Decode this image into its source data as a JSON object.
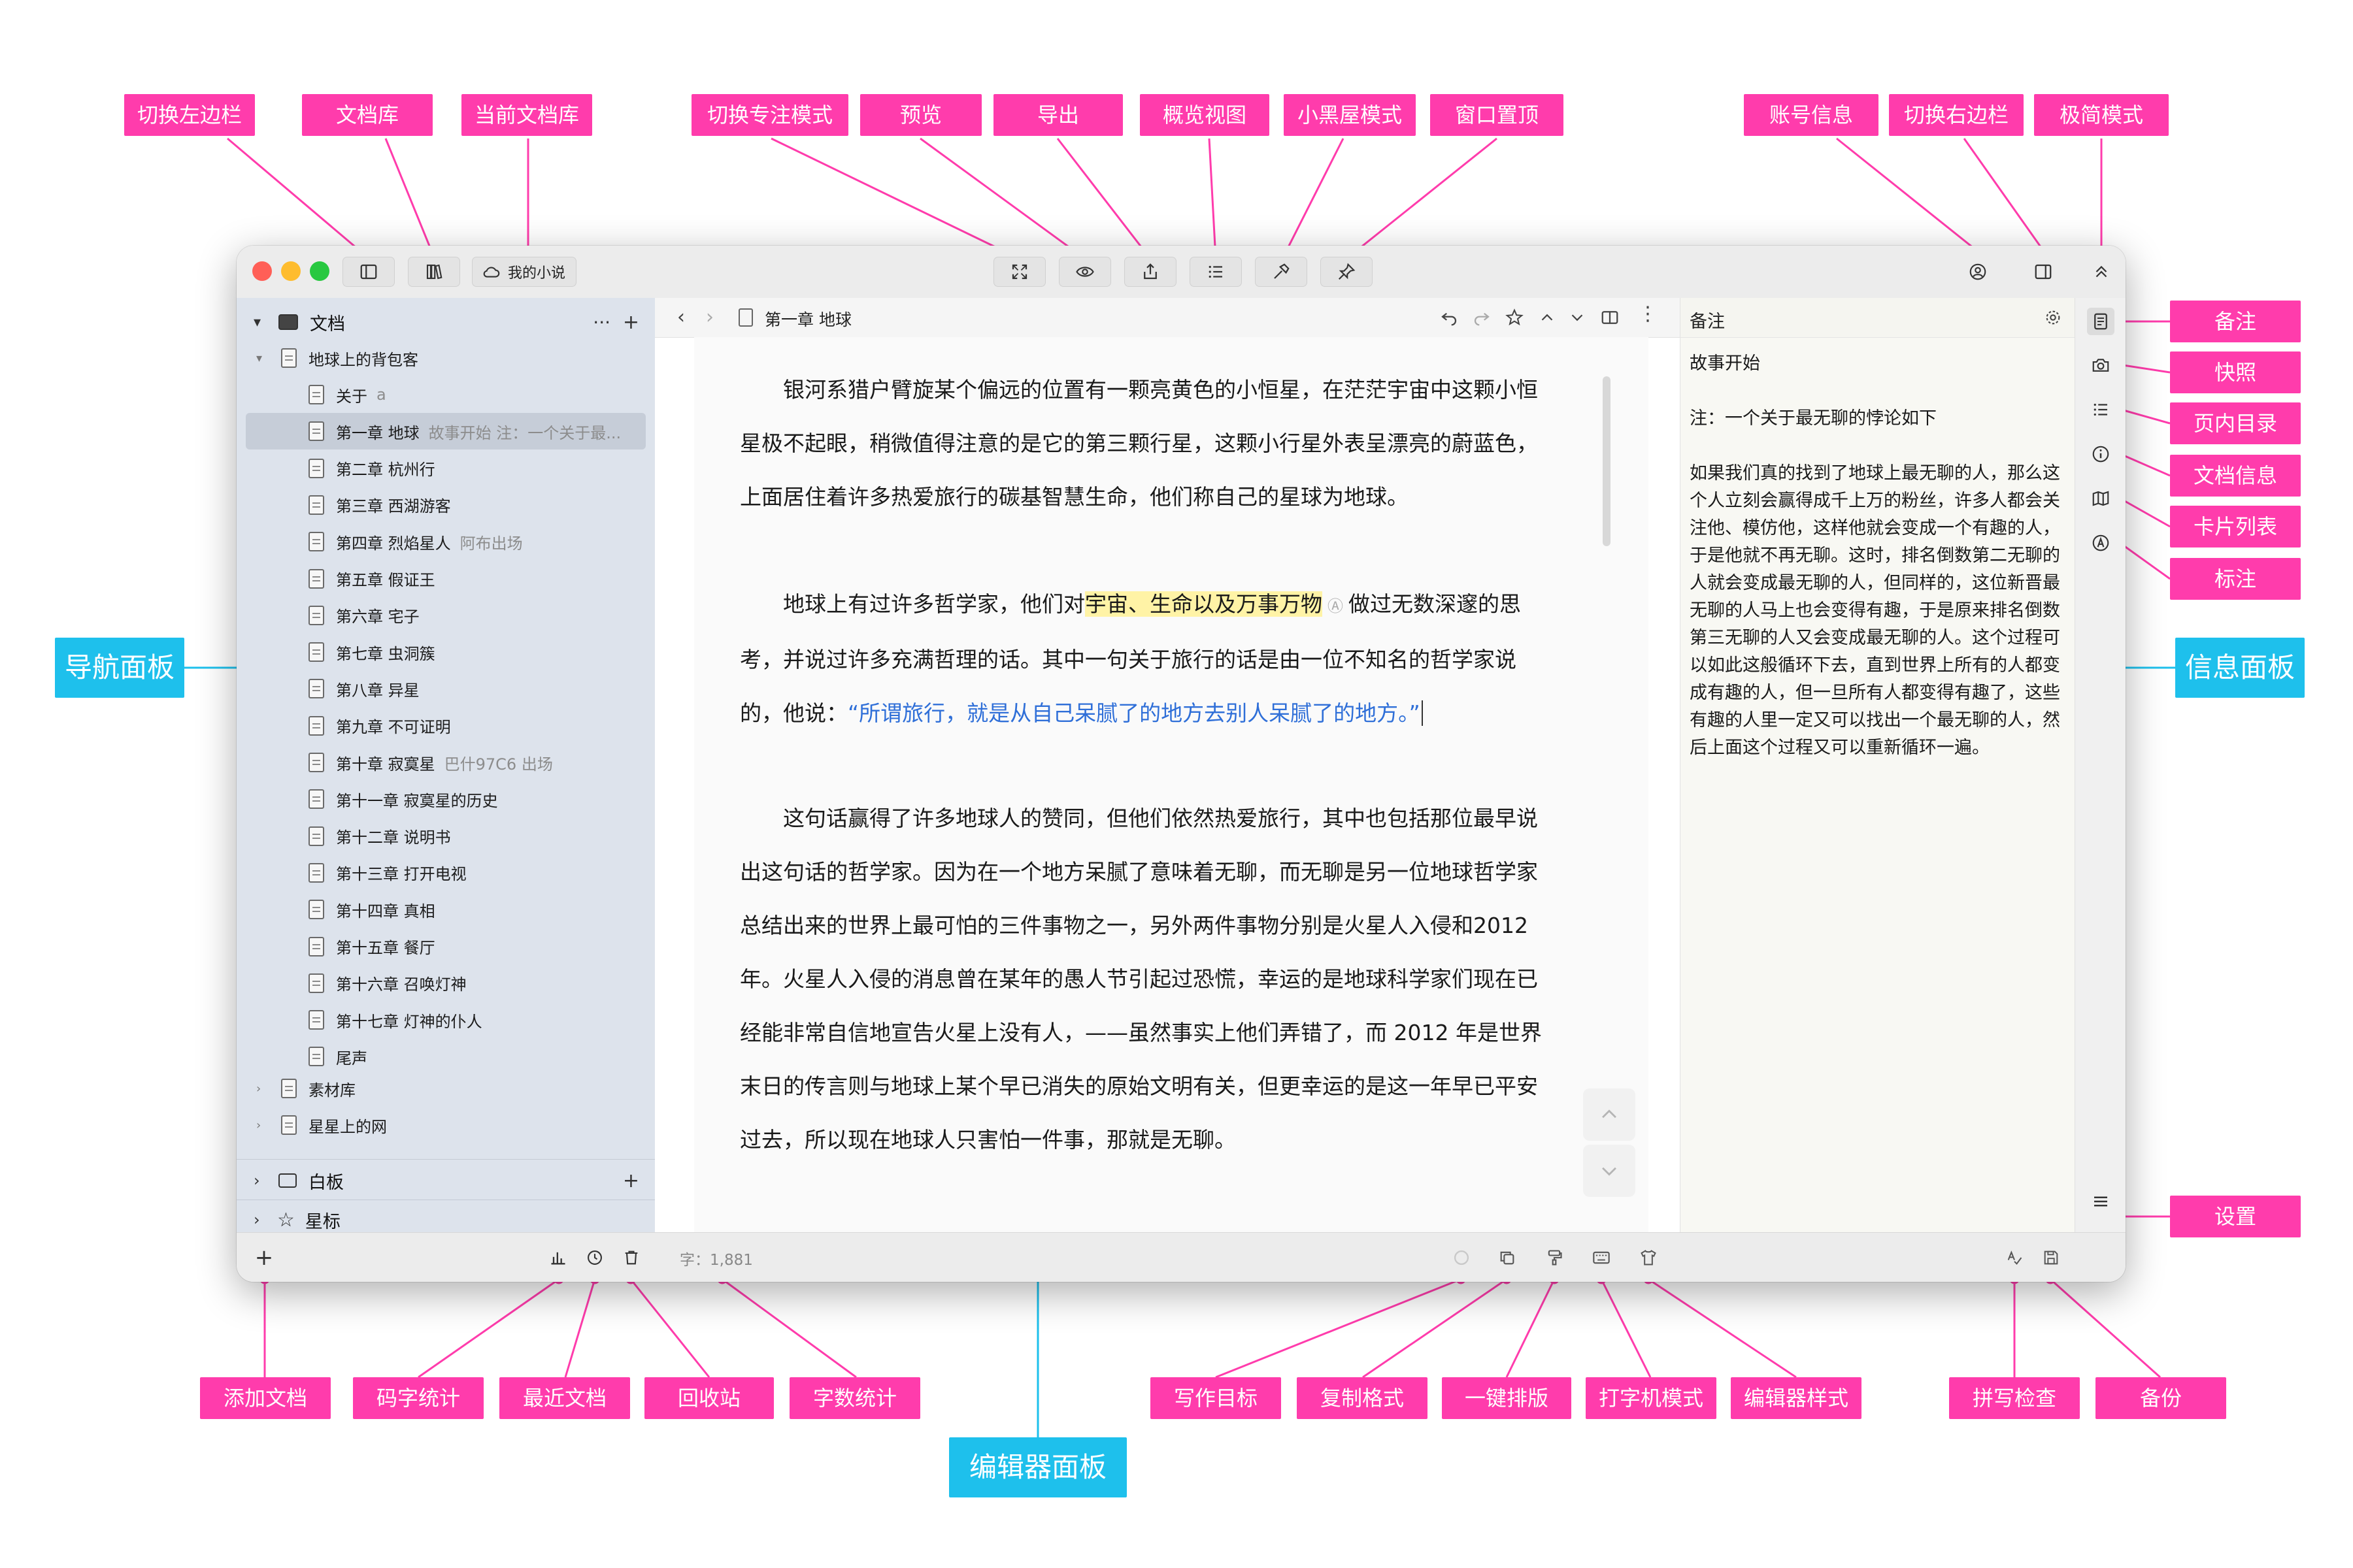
{
  "callouts": {
    "toggle_left": "切换左边栏",
    "library": "文档库",
    "current_library": "当前文档库",
    "focus_mode": "切换专注模式",
    "preview": "预览",
    "export": "导出",
    "overview": "概览视图",
    "dark_room": "小黑屋模式",
    "pin_window": "窗口置顶",
    "account": "账号信息",
    "toggle_right": "切换右边栏",
    "minimal": "极简模式",
    "notes": "备注",
    "snapshot": "快照",
    "toc": "页内目录",
    "doc_info": "文档信息",
    "cards": "卡片列表",
    "annotations": "标注",
    "settings": "设置",
    "nav_panel": "导航面板",
    "info_panel": "信息面板",
    "editor_panel": "编辑器面板",
    "add_doc": "添加文档",
    "typing_stats": "码字统计",
    "recent_docs": "最近文档",
    "trash": "回收站",
    "word_stats": "字数统计",
    "writing_goal": "写作目标",
    "copy_format": "复制格式",
    "auto_layout": "一键排版",
    "typewriter": "打字机模式",
    "editor_style": "编辑器样式",
    "spellcheck": "拼写检查",
    "backup": "备份"
  },
  "titlebar": {
    "library_name": "我的小说"
  },
  "nav": {
    "root_label": "文档",
    "book": "地球上的背包客",
    "items": [
      {
        "title": "关于",
        "sub": "a"
      },
      {
        "title": "第一章 地球",
        "sub": "故事开始 注：一个关于最..."
      },
      {
        "title": "第二章 杭州行",
        "sub": ""
      },
      {
        "title": "第三章 西湖游客",
        "sub": ""
      },
      {
        "title": "第四章 烈焰星人",
        "sub": "阿布出场"
      },
      {
        "title": "第五章 假证王",
        "sub": ""
      },
      {
        "title": "第六章 宅子",
        "sub": ""
      },
      {
        "title": "第七章 虫洞簇",
        "sub": ""
      },
      {
        "title": "第八章 异星",
        "sub": ""
      },
      {
        "title": "第九章 不可证明",
        "sub": ""
      },
      {
        "title": "第十章 寂寞星",
        "sub": "巴什97C6 出场"
      },
      {
        "title": "第十一章 寂寞星的历史",
        "sub": ""
      },
      {
        "title": "第十二章 说明书",
        "sub": ""
      },
      {
        "title": "第十三章 打开电视",
        "sub": ""
      },
      {
        "title": "第十四章 真相",
        "sub": ""
      },
      {
        "title": "第十五章 餐厅",
        "sub": ""
      },
      {
        "title": "第十六章 召唤灯神",
        "sub": ""
      },
      {
        "title": "第十七章 灯神的仆人",
        "sub": ""
      },
      {
        "title": "尾声",
        "sub": ""
      }
    ],
    "other_books": [
      "素材库",
      "星星上的网"
    ],
    "whiteboard": "白板",
    "stars": "星标"
  },
  "editor": {
    "doc_title": "第一章 地球",
    "p1": "银河系猎户臂旋某个偏远的位置有一颗亮黄色的小恒星，在茫茫宇宙中这颗小恒星极不起眼，稍微值得注意的是它的第三颗行星，这颗小行星外表呈漂亮的蔚蓝色，上面居住着许多热爱旅行的碳基智慧生命，他们称自己的星球为地球。",
    "p2_a": "地球上有过许多哲学家，他们对",
    "p2_hl": "宇宙、生命以及万事万物",
    "p2_b": "做过无数深邃的思考，并说过许多充满哲理的话。其中一句关于旅行的话是由一位不知名的哲学家说的，他说：",
    "p2_quote": "“所谓旅行，就是从自己呆腻了的地方去别人呆腻了的地方。”",
    "p3": "这句话赢得了许多地球人的赞同，但他们依然热爱旅行，其中也包括那位最早说出这句话的哲学家。因为在一个地方呆腻了意味着无聊，而无聊是另一位地球哲学家总结出来的世界上最可怕的三件事物之一，另外两件事物分别是火星人入侵和2012 年。火星人入侵的消息曾在某年的愚人节引起过恐慌，幸运的是地球科学家们现在已经能非常自信地宣告火星上没有人，——虽然事实上他们弄错了，而 2012 年是世界末日的传言则与地球上某个早已消失的原始文明有关，但更幸运的是这一年早已平安过去，所以现在地球人只害怕一件事，那就是无聊。"
  },
  "info": {
    "header": "备注",
    "line1": "故事开始",
    "line2": "注：一个关于最无聊的悖论如下",
    "body": "如果我们真的找到了地球上最无聊的人，那么这个人立刻会赢得成千上万的粉丝，许多人都会关注他、模仿他，这样他就会变成一个有趣的人，于是他就不再无聊。这时，排名倒数第二无聊的人就会变成最无聊的人，但同样的，这位新晋最无聊的人马上也会变得有趣，于是原来排名倒数第三无聊的人又会变成最无聊的人。这个过程可以如此这般循环下去，直到世界上所有的人都变成有趣的人，但一旦所有人都变得有趣了，这些有趣的人里一定又可以找出一个最无聊的人，然后上面这个过程又可以重新循环一遍。"
  },
  "status": {
    "word_count": "字：1,881"
  },
  "colors": {
    "callout": "#ff3cac",
    "panel_callout": "#1ec0ec",
    "highlight": "#fff3a6",
    "quote": "#2f6fd8"
  }
}
